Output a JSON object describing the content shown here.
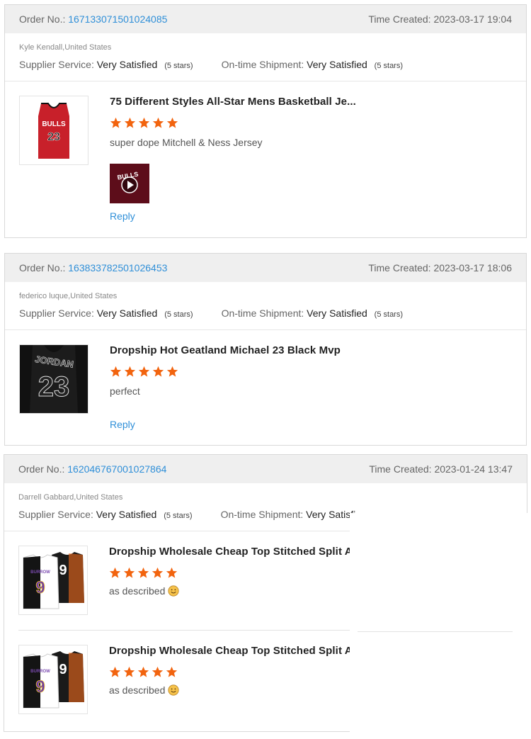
{
  "labels": {
    "order_no": "Order No.:",
    "time_created": "Time Created:",
    "supplier_service": "Supplier Service:",
    "ontime_shipment": "On-time Shipment:",
    "reply": "Reply"
  },
  "orders": [
    {
      "order_number": "167133071501024085",
      "time_created": "2023-03-17 19:04",
      "buyer": "Kyle Kendall,United States",
      "supplier_rating": "Very Satisfied",
      "supplier_stars": "(5 stars)",
      "shipment_rating": "Very Satisfied",
      "shipment_stars": "(5 stars)",
      "items": [
        {
          "title": "75 Different Styles All-Star Mens Basketball Je...",
          "stars": 5,
          "comment": "super dope Mitchell & Ness Jersey",
          "thumb_jersey_text": "BULLS",
          "thumb_jersey_number": "23",
          "media_label": "BULLS"
        }
      ]
    },
    {
      "order_number": "163833782501026453",
      "time_created": "2023-03-17 18:06",
      "buyer": "federico luque,United States",
      "supplier_rating": "Very Satisfied",
      "supplier_stars": "(5 stars)",
      "shipment_rating": "Very Satisfied",
      "shipment_stars": "(5 stars)",
      "items": [
        {
          "title": "Dropship Hot Geatland Michael 23 Black Mvp",
          "stars": 5,
          "comment": "perfect",
          "thumb_jersey_text": "JORDAN",
          "thumb_jersey_number": "23"
        }
      ]
    },
    {
      "order_number": "162046767001027864",
      "time_created": "2023-01-24 13:47",
      "buyer": "Darrell Gabbard,United States",
      "supplier_rating": "Very Satisfied",
      "supplier_stars": "(5 stars)",
      "shipment_rating": "Very Satisfi",
      "items": [
        {
          "title": "Dropship Wholesale Cheap Top Stitched Split A...",
          "stars": 5,
          "comment": "as described",
          "thumb_jersey_text": "BURROW",
          "thumb_jersey_number": "9"
        },
        {
          "title": "Dropship Wholesale Cheap Top Stitched Split A...",
          "stars": 5,
          "comment": "as described",
          "thumb_jersey_text": "BURROW",
          "thumb_jersey_number": "9"
        }
      ]
    }
  ],
  "colors": {
    "accent_link": "#2f8fd8",
    "star": "#f2640f",
    "header_bg": "#efefef"
  }
}
